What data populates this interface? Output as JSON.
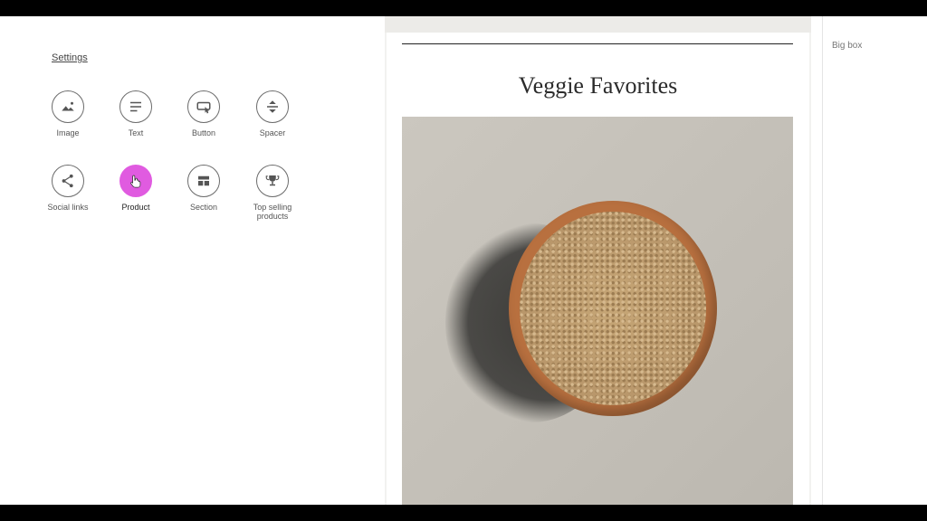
{
  "settings_link": "Settings",
  "tiles": [
    {
      "label": "Image",
      "icon": "image-icon"
    },
    {
      "label": "Text",
      "icon": "text-icon"
    },
    {
      "label": "Button",
      "icon": "button-icon"
    },
    {
      "label": "Spacer",
      "icon": "spacer-icon"
    },
    {
      "label": "Social links",
      "icon": "share-icon"
    },
    {
      "label": "Product",
      "icon": "product-icon",
      "active": true
    },
    {
      "label": "Section",
      "icon": "section-icon"
    },
    {
      "label": "Top selling\nproducts",
      "icon": "trophy-icon"
    }
  ],
  "email": {
    "heading": "Veggie Favorites",
    "image_alt": "bowl of quinoa"
  },
  "right_panel": {
    "label": "Big box"
  },
  "colors": {
    "active": "#e05be0"
  }
}
